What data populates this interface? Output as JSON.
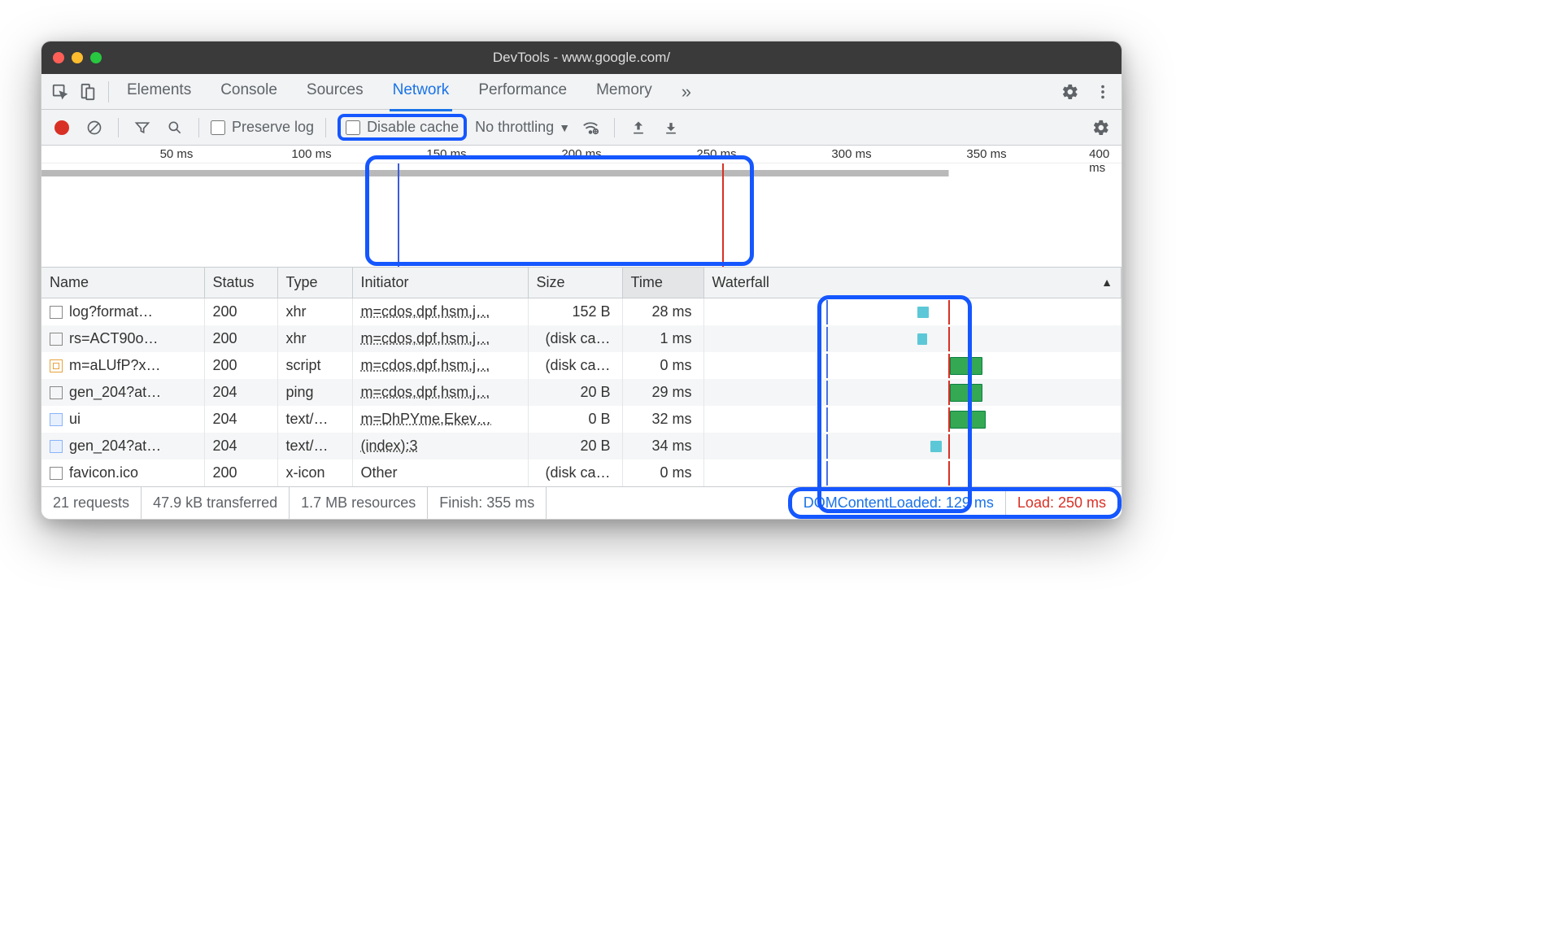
{
  "window": {
    "title": "DevTools - www.google.com/"
  },
  "tabs": {
    "items": [
      "Elements",
      "Console",
      "Sources",
      "Network",
      "Performance",
      "Memory"
    ],
    "active": "Network",
    "overflow_glyph": "»"
  },
  "toolbar": {
    "preserve_log_label": "Preserve log",
    "disable_cache_label": "Disable cache",
    "throttling_label": "No throttling"
  },
  "overview": {
    "ticks": [
      "50 ms",
      "100 ms",
      "150 ms",
      "200 ms",
      "250 ms",
      "300 ms",
      "350 ms",
      "400 ms"
    ]
  },
  "columns": {
    "name": "Name",
    "status": "Status",
    "type": "Type",
    "initiator": "Initiator",
    "size": "Size",
    "time": "Time",
    "waterfall": "Waterfall"
  },
  "rows": [
    {
      "name": "log?format…",
      "status": "200",
      "type": "xhr",
      "initiator": "m=cdos,dpf,hsm,j…",
      "size": "152 B",
      "time": "28 ms",
      "icon": "plain"
    },
    {
      "name": "rs=ACT90o…",
      "status": "200",
      "type": "xhr",
      "initiator": "m=cdos,dpf,hsm,j…",
      "size": "(disk ca…",
      "time": "1 ms",
      "icon": "plain"
    },
    {
      "name": "m=aLUfP?x…",
      "status": "200",
      "type": "script",
      "initiator": "m=cdos,dpf,hsm,j…",
      "size": "(disk ca…",
      "time": "0 ms",
      "icon": "script"
    },
    {
      "name": "gen_204?at…",
      "status": "204",
      "type": "ping",
      "initiator": "m=cdos,dpf,hsm,j…",
      "size": "20 B",
      "time": "29 ms",
      "icon": "plain"
    },
    {
      "name": "ui",
      "status": "204",
      "type": "text/…",
      "initiator": "m=DhPYme,Ekev…",
      "size": "0 B",
      "time": "32 ms",
      "icon": "img"
    },
    {
      "name": "gen_204?at…",
      "status": "204",
      "type": "text/…",
      "initiator": "(index):3",
      "size": "20 B",
      "time": "34 ms",
      "icon": "img"
    },
    {
      "name": "favicon.ico",
      "status": "200",
      "type": "x-icon",
      "initiator": "Other",
      "size": "(disk ca…",
      "time": "0 ms",
      "icon": "plain",
      "initiator_plain": true
    }
  ],
  "status": {
    "requests": "21 requests",
    "transferred": "47.9 kB transferred",
    "resources": "1.7 MB resources",
    "finish": "Finish: 355 ms",
    "dcl": "DOMContentLoaded: 129 ms",
    "load": "Load: 250 ms"
  }
}
